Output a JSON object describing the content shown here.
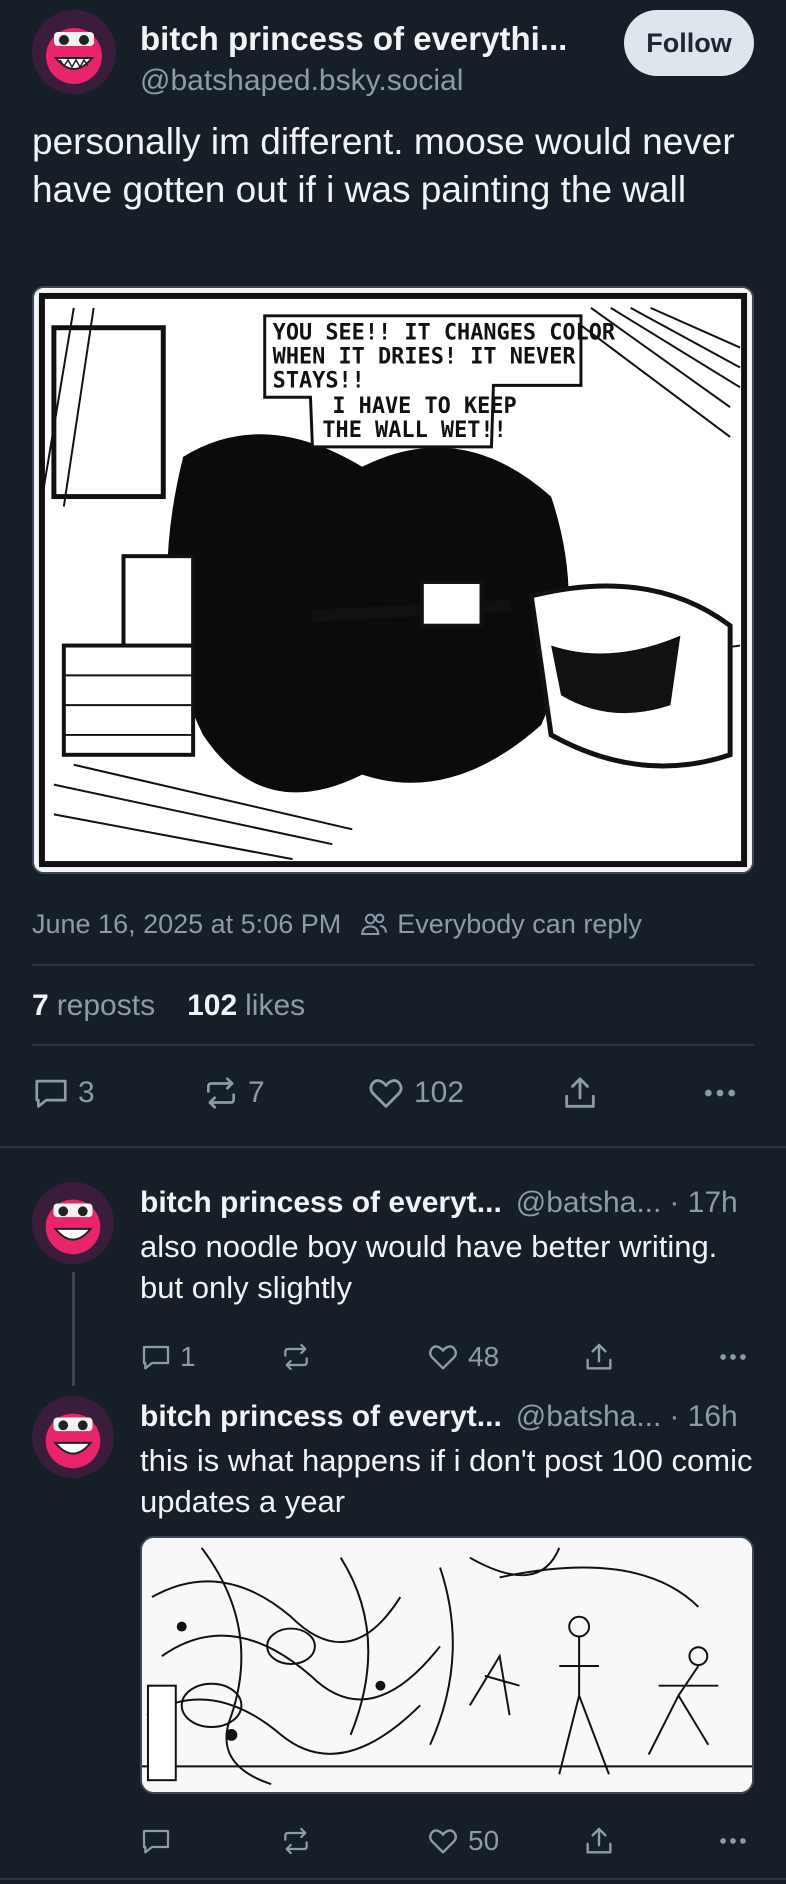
{
  "post": {
    "author_name": "bitch princess of everythi...",
    "author_handle": "@batshaped.bsky.social",
    "follow_label": "Follow",
    "text": "personally im different. moose would never have gotten out if i was painting the wall",
    "image_caption_lines": [
      "YOU SEE!! IT CHANGES COLOR",
      "WHEN IT DRIES! IT NEVER",
      "STAYS!!",
      "I HAVE TO KEEP",
      "THE WALL WET!!"
    ],
    "timestamp": "June 16, 2025 at 5:06 PM",
    "reply_setting": "Everybody can reply",
    "stats": {
      "reposts_count": "7",
      "reposts_label": "reposts",
      "likes_count": "102",
      "likes_label": "likes"
    },
    "actions": {
      "replies": "3",
      "reposts": "7",
      "likes": "102"
    }
  },
  "replies": [
    {
      "author_name": "bitch princess of everyt...",
      "author_handle": "@batsha...",
      "time": "· 17h",
      "text": "also noodle boy would have better writing. but only slightly",
      "replies": "1",
      "reposts": "",
      "likes": "48"
    },
    {
      "author_name": "bitch princess of everyt...",
      "author_handle": "@batsha...",
      "time": "· 16h",
      "text": "this is what happens if i don't post 100 comic updates a year",
      "replies": "",
      "reposts": "",
      "likes": "50"
    }
  ],
  "colors": {
    "background": "#161e27",
    "text": "#f1f3f5",
    "muted": "#8c9bab",
    "divider": "#2b3644",
    "avatar_pink": "#e8246a"
  },
  "icons": [
    "reply-icon",
    "repost-icon",
    "like-icon",
    "share-icon",
    "more-icon",
    "people-icon"
  ]
}
